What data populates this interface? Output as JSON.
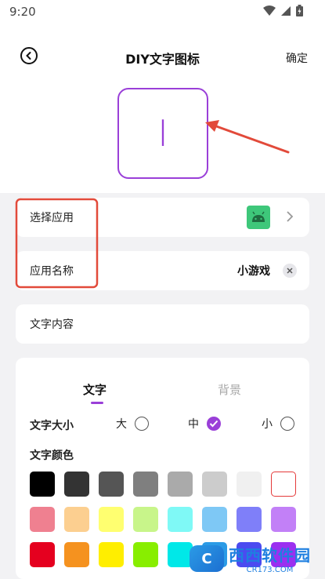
{
  "status_bar": {
    "time": "9:20"
  },
  "header": {
    "title": "DIY文字图标",
    "confirm_label": "确定"
  },
  "preview": {
    "text": "I",
    "border_color": "#9a3fd8"
  },
  "rows": {
    "select_app": {
      "label": "选择应用"
    },
    "app_name": {
      "label": "应用名称",
      "value": "小游戏"
    },
    "text_content": {
      "label": "文字内容"
    }
  },
  "settings": {
    "tabs": [
      {
        "label": "文字",
        "active": true
      },
      {
        "label": "背景",
        "active": false
      }
    ],
    "size_label": "文字大小",
    "size_options": [
      {
        "label": "大",
        "checked": false
      },
      {
        "label": "中",
        "checked": true
      },
      {
        "label": "小",
        "checked": false
      }
    ],
    "color_label": "文字颜色",
    "colors": [
      [
        "#000000",
        "#333333",
        "#555555",
        "#7f7f7f",
        "#aaaaaa",
        "#cccccc",
        "#f0f0f0",
        "#ffffff"
      ],
      [
        "#ef8090",
        "#fccf90",
        "#ffff70",
        "#c8f58a",
        "#7ff9f6",
        "#7ec8f5",
        "#7f7ff9",
        "#c280f7"
      ],
      [
        "#e5001f",
        "#f5921f",
        "#ffee00",
        "#88ee00",
        "#00e8e8",
        "#2b9be6",
        "#4b4bf0",
        "#9b30f0"
      ]
    ]
  },
  "watermark": {
    "logo_text": "C",
    "title": "西西软件园",
    "url": "CR173.COM"
  }
}
